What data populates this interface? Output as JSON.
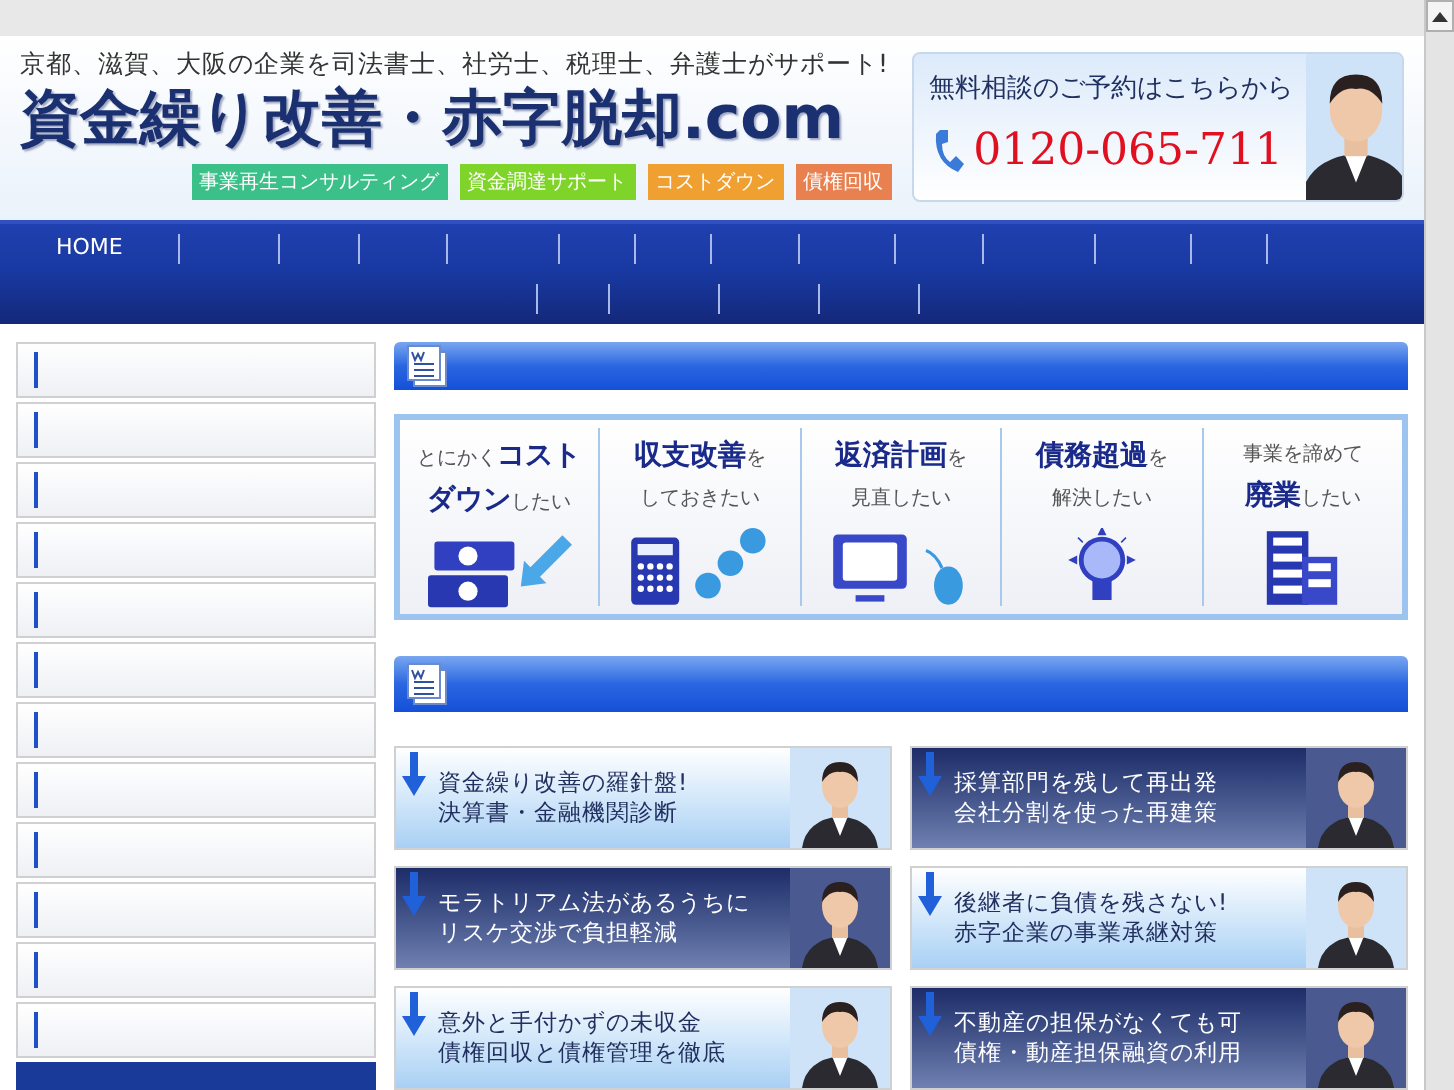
{
  "header": {
    "tagline": "京都、滋賀、大阪の企業を司法書士、社労士、税理士、弁護士がサポート!",
    "logo": "資金繰り改善・赤字脱却.com",
    "badges": [
      {
        "label": "事業再生コンサルティング",
        "color": "#3cc08a"
      },
      {
        "label": "資金調達サポート",
        "color": "#7fd42a"
      },
      {
        "label": "コストダウン",
        "color": "#f0a030"
      },
      {
        "label": "債権回収",
        "color": "#e88050"
      }
    ],
    "contact": {
      "lead": "無料相談のご予約はこちらから",
      "phone": "0120-065-711"
    }
  },
  "nav": {
    "items": [
      "HOME"
    ]
  },
  "services": [
    {
      "line1": "とにかく**コスト**",
      "line2": "**ダウン**したい",
      "kind": "cash"
    },
    {
      "line1": "**収支改善**を",
      "line2": "しておきたい",
      "kind": "calculator"
    },
    {
      "line1": "**返済計画**を",
      "line2": "見直したい",
      "kind": "monitor"
    },
    {
      "line1": "**債務超過**を",
      "line2": "解決したい",
      "kind": "bulb"
    },
    {
      "line1": "事業を諦めて",
      "line2": "**廃業**したい",
      "kind": "building"
    }
  ],
  "cards": [
    {
      "line1": "資金繰り改善の羅針盤!",
      "line2": "決算書・金融機関診断",
      "kind": "light"
    },
    {
      "line1": "採算部門を残して再出発",
      "line2": "会社分割を使った再建策",
      "kind": "dark"
    },
    {
      "line1": "モラトリアム法があるうちに",
      "line2": "リスケ交渉で負担軽減",
      "kind": "dark"
    },
    {
      "line1": "後継者に負債を残さない!",
      "line2": "赤字企業の事業承継対策",
      "kind": "light"
    },
    {
      "line1": "意外と手付かずの未収金",
      "line2": "債権回収と債権管理を徹底",
      "kind": "light"
    },
    {
      "line1": "不動産の担保がなくても可",
      "line2": "債権・動産担保融資の利用",
      "kind": "dark"
    }
  ]
}
